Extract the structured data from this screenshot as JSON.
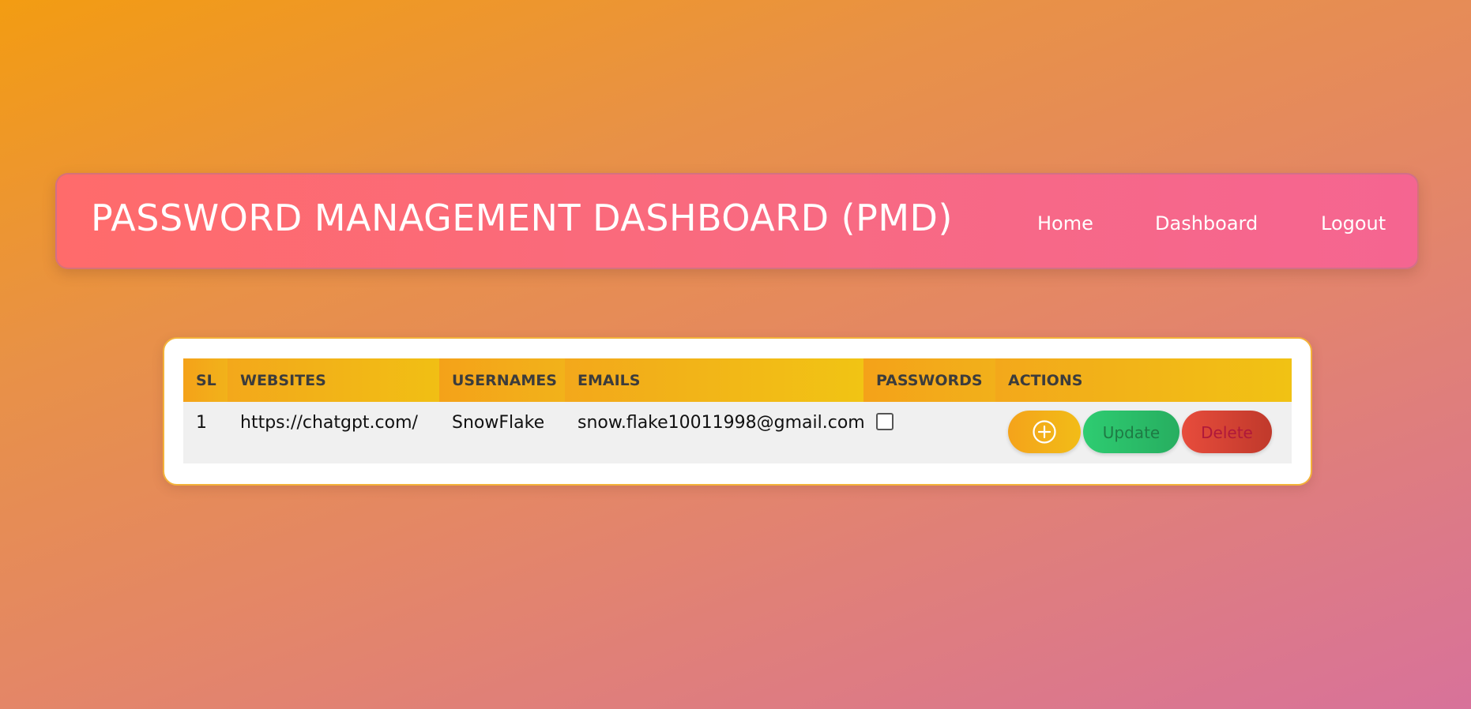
{
  "navbar": {
    "brand": "PASSWORD MANAGEMENT DASHBOARD (PMD)",
    "links": [
      {
        "label": "Home"
      },
      {
        "label": "Dashboard"
      },
      {
        "label": "Logout"
      }
    ]
  },
  "table": {
    "headers": {
      "sl": "SL",
      "websites": "WEBSITES",
      "usernames": "USERNAMES",
      "emails": "EMAILS",
      "passwords": "PASSWORDS",
      "actions": "ACTIONS"
    },
    "rows": [
      {
        "sl": "1",
        "website": "https://chatgpt.com/",
        "username": "SnowFlake",
        "email": "snow.flake10011998@gmail.com",
        "password_visible": false
      }
    ],
    "actions": {
      "add_icon": "plus-circle-icon",
      "update_label": "Update",
      "delete_label": "Delete"
    }
  },
  "colors": {
    "navbar_start": "#ff6b6b",
    "navbar_end": "#f56591",
    "table_header": "#f2b21a",
    "update": "#2ecc71",
    "delete": "#e74c3c"
  }
}
